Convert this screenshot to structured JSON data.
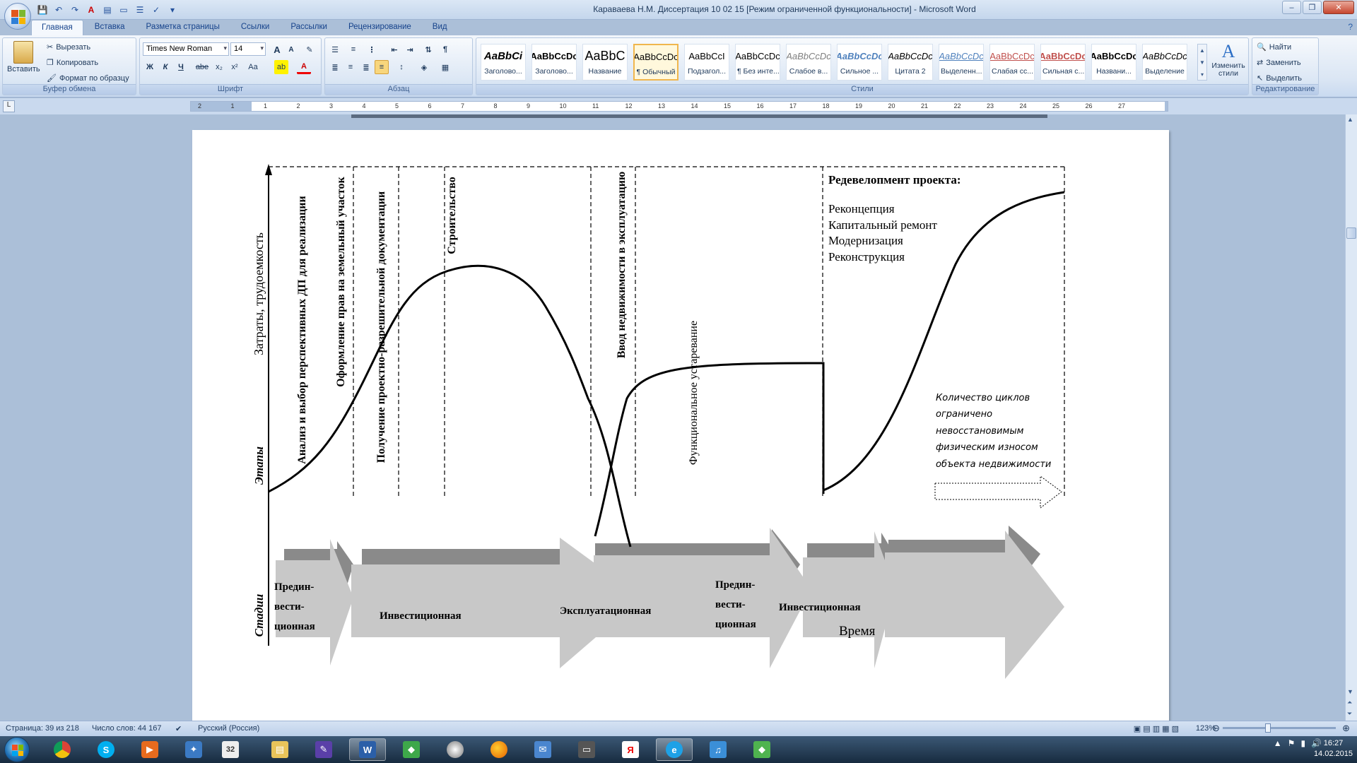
{
  "window": {
    "title": "Караваева Н.М. Диссертация 10 02 15 [Режим ограниченной функциональности] - Microsoft Word",
    "minimize": "–",
    "restore": "❐",
    "close": "✕"
  },
  "tabs": [
    {
      "label": "Главная",
      "active": true
    },
    {
      "label": "Вставка"
    },
    {
      "label": "Разметка страницы"
    },
    {
      "label": "Ссылки"
    },
    {
      "label": "Рассылки"
    },
    {
      "label": "Рецензирование"
    },
    {
      "label": "Вид"
    }
  ],
  "ribbon": {
    "clipboard": {
      "label": "Буфер обмена",
      "paste": "Вставить",
      "cut": "Вырезать",
      "copy": "Копировать",
      "format_painter": "Формат по образцу"
    },
    "font": {
      "label": "Шрифт",
      "font_name": "Times New Roman",
      "font_size": "14",
      "bold": "Ж",
      "italic": "К",
      "underline": "Ч",
      "strike": "abe",
      "subscript": "x₂",
      "superscript": "x²",
      "case": "Aa",
      "grow": "A",
      "shrink": "A",
      "clear": "✎",
      "highlight": "ab",
      "color": "A"
    },
    "paragraph": {
      "label": "Абзац",
      "pilcrow": "¶"
    },
    "styles": {
      "label": "Стили",
      "items": [
        {
          "sample": "AaBbCi",
          "name": "Заголово..."
        },
        {
          "sample": "AaBbCcDc",
          "name": "Заголово..."
        },
        {
          "sample": "AaBbC",
          "name": "Название"
        },
        {
          "sample": "AaBbCcDc",
          "name": "¶ Обычный",
          "selected": true
        },
        {
          "sample": "AaBbCcI",
          "name": "Подзагол..."
        },
        {
          "sample": "AaBbCcDc",
          "name": "¶ Без инте..."
        },
        {
          "sample": "AaBbCcDc",
          "name": "Слабое в..."
        },
        {
          "sample": "AaBbCcDc",
          "name": "Сильное ..."
        },
        {
          "sample": "AaBbCcDc",
          "name": "Цитата 2"
        },
        {
          "sample": "AaBbCcDc",
          "name": "Выделенн..."
        },
        {
          "sample": "AaBbCcDc",
          "name": "Слабая сс..."
        },
        {
          "sample": "AaBbCcDc",
          "name": "Сильная с..."
        },
        {
          "sample": "AaBbCcDc",
          "name": "Названи..."
        },
        {
          "sample": "AaBbCcDc",
          "name": "Выделение"
        }
      ],
      "change_styles": "Изменить стили"
    },
    "editing": {
      "label": "Редактирование",
      "find": "Найти",
      "replace": "Заменить",
      "select": "Выделить"
    }
  },
  "ruler": {
    "numbers": [
      "2",
      "1",
      "1",
      "2",
      "3",
      "4",
      "5",
      "6",
      "7",
      "8",
      "9",
      "10",
      "11",
      "12",
      "13",
      "14",
      "15",
      "16",
      "17",
      "18",
      "19",
      "20",
      "21",
      "22",
      "23",
      "24",
      "25",
      "26",
      "27"
    ]
  },
  "diagram": {
    "y_axis_label": "Затраты, трудоемкость",
    "x_axis_label": "Время",
    "row_label_stages": "Этапы",
    "row_label_phases": "Стадии",
    "stage_labels": [
      "Анализ и выбор перспективных ДП для реализации",
      "Оформление прав на земельный участок",
      "Получение проектно-разрешительной документации",
      "Строительство",
      "Ввод недвижимости в эксплуатацию",
      "Функциональное устаревание"
    ],
    "redevelopment_title": "Редевелопмент  проекта:",
    "redevelopment_items": [
      "Реконцепция",
      "Капитальный ремонт",
      "Модернизация",
      "Реконструкция"
    ],
    "cycles_note": [
      "Количество циклов",
      "ограничено",
      "невосстановимым",
      "физическим износом",
      "объекта недвижимости"
    ],
    "phases": [
      {
        "lines": [
          "Предин-",
          "вести-",
          "ционная"
        ]
      },
      {
        "lines": [
          "Инвестиционная"
        ]
      },
      {
        "lines": [
          "Эксплуатационная"
        ]
      },
      {
        "lines": [
          "Предин-",
          "вести-",
          "ционная"
        ]
      },
      {
        "lines": [
          "Инвестиционная"
        ]
      }
    ]
  },
  "status": {
    "page": "Страница: 39 из 218",
    "words": "Число слов: 44 167",
    "language": "Русский (Россия)",
    "zoom": "123%"
  },
  "taskbar": {
    "icons": [
      "chrome-icon",
      "skype-icon",
      "media-icon",
      "network-icon",
      "calendar-icon",
      "explorer-icon",
      "pen-icon",
      "word-icon",
      "sims-icon",
      "disc-icon",
      "firefox-icon",
      "mail-icon",
      "tv-icon",
      "yandex-icon",
      "ie-icon",
      "music-icon",
      "sims2-icon"
    ],
    "calendar_day": "32",
    "time": "16:27",
    "date": "14.02.2015"
  },
  "colors": {
    "arrow_light": "#c8c8c8",
    "arrow_dark": "#8a8a8a",
    "ribbon_bg": "#dbe6f4",
    "doc_bg": "#abbfd8"
  }
}
